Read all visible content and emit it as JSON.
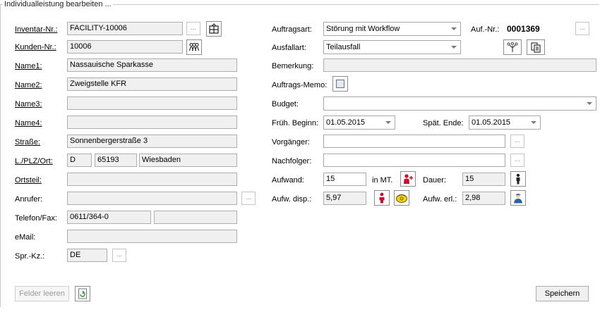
{
  "group_title": "Individualleistung bearbeiten ...",
  "left": {
    "inventar_label": "Inventar-Nr.:",
    "inventar_value": "FACILITY-10006",
    "kunden_label": "Kunden-Nr.:",
    "kunden_value": "10006",
    "name1_label": "Name1:",
    "name1_value": "Nassauische Sparkasse",
    "name2_label": "Name2:",
    "name2_value": "Zweigstelle KFR",
    "name3_label": "Name3:",
    "name3_value": "",
    "name4_label": "Name4:",
    "name4_value": "",
    "strasse_label": "Straße:",
    "strasse_value": "Sonnenbergerstraße 3",
    "lplzort_label": "L./PLZ/Ort:",
    "land_value": "D",
    "plz_value": "65193",
    "ort_value": "Wiesbaden",
    "ortsteil_label": "Ortsteil:",
    "ortsteil_value": "",
    "anrufer_label": "Anrufer:",
    "anrufer_value": "",
    "telefon_label": "Telefon/Fax:",
    "telefon_value": "0611/364-0",
    "fax_value": "",
    "email_label": "eMail:",
    "email_value": "",
    "sprkz_label": "Spr.-Kz.:",
    "sprkz_value": "DE",
    "dots": "..."
  },
  "right": {
    "auftragsart_label": "Auftragsart:",
    "auftragsart_value": "Störung mit Workflow",
    "aufnr_label": "Auf.-Nr.:",
    "aufnr_value": "0001369",
    "ausfallart_label": "Ausfallart:",
    "ausfallart_value": "Teilausfall",
    "bemerkung_label": "Bemerkung:",
    "bemerkung_value": "",
    "memo_label": "Auftrags-Memo:",
    "budget_label": "Budget:",
    "budget_value": "",
    "fruh_label": "Früh. Beginn:",
    "fruh_value": "01.05.2015",
    "spat_label": "Spät. Ende:",
    "spat_value": "01.05.2015",
    "vorganger_label": "Vorgänger:",
    "vorganger_value": "",
    "nachfolger_label": "Nachfolger:",
    "nachfolger_value": "",
    "aufwand_label": "Aufwand:",
    "aufwand_value": "15",
    "inmt_label": "in MT.",
    "dauer_label": "Dauer:",
    "dauer_value": "15",
    "aufwdisp_label": "Aufw. disp.:",
    "aufwdisp_value": "5,97",
    "aufwerl_label": "Aufw. erl.:",
    "aufwerl_value": "2,98"
  },
  "footer": {
    "felder_leeren": "Felder leeren",
    "speichern": "Speichern"
  },
  "icons": {
    "inventar": "building-grid-icon",
    "kunden": "people-group-icon",
    "workflow": "tree-hierarchy-icon",
    "docs": "documents-copy-icon",
    "memo": "memo-note-icon",
    "aufwand_person": "person-add-icon",
    "dauer_person": "person-standing-icon",
    "disp_person": "person-red-icon",
    "disp_phone": "phone-icon",
    "erl_person": "worker-icon",
    "refresh": "refresh-icon"
  }
}
